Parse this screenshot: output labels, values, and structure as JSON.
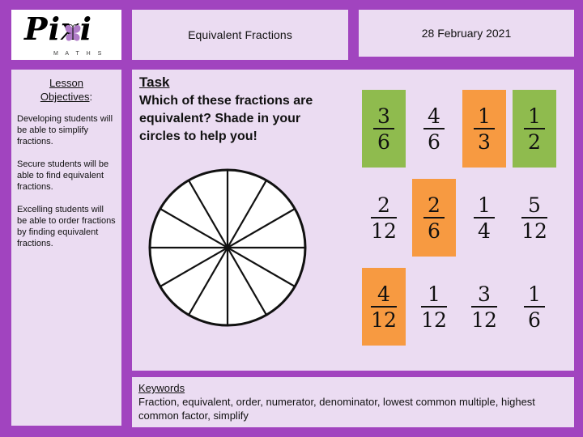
{
  "theme": {
    "border_purple": "#a144bf",
    "panel_lavender": "#ebdcf2",
    "highlight_green": "#8fbb4e",
    "highlight_orange": "#f79a41",
    "text_color": "#111111"
  },
  "logo": {
    "wordmark": "Pixi",
    "subtitle": "M A T H S",
    "icon": "butterfly-icon"
  },
  "header": {
    "title": "Equivalent Fractions",
    "date": "28 February 2021"
  },
  "objectives": {
    "heading_line1": "Lesson",
    "heading_line2": "Objectives",
    "heading_suffix": ":",
    "items": [
      "Developing students will be able to simplify fractions.",
      "Secure students will be able to find equivalent fractions.",
      "Excelling students will be able to order fractions by finding equivalent fractions."
    ]
  },
  "task": {
    "heading": "Task",
    "body": "Which of these fractions are equivalent? Shade in your circles to help you!"
  },
  "circle": {
    "segments": 12,
    "label": "twelfth-segmented-circle"
  },
  "fraction_grid": {
    "rows": 3,
    "columns": 4,
    "cells": [
      {
        "numerator": "3",
        "denominator": "6",
        "highlight": "green"
      },
      {
        "numerator": "4",
        "denominator": "6",
        "highlight": "none"
      },
      {
        "numerator": "1",
        "denominator": "3",
        "highlight": "orange"
      },
      {
        "numerator": "1",
        "denominator": "2",
        "highlight": "green"
      },
      {
        "numerator": "2",
        "denominator": "12",
        "highlight": "none"
      },
      {
        "numerator": "2",
        "denominator": "6",
        "highlight": "orange"
      },
      {
        "numerator": "1",
        "denominator": "4",
        "highlight": "none"
      },
      {
        "numerator": "5",
        "denominator": "12",
        "highlight": "none"
      },
      {
        "numerator": "4",
        "denominator": "12",
        "highlight": "orange"
      },
      {
        "numerator": "1",
        "denominator": "12",
        "highlight": "none"
      },
      {
        "numerator": "3",
        "denominator": "12",
        "highlight": "none"
      },
      {
        "numerator": "1",
        "denominator": "6",
        "highlight": "none"
      }
    ]
  },
  "keywords": {
    "heading": "Keywords",
    "body": "Fraction, equivalent, order, numerator, denominator, lowest common multiple, highest common factor, simplify"
  }
}
